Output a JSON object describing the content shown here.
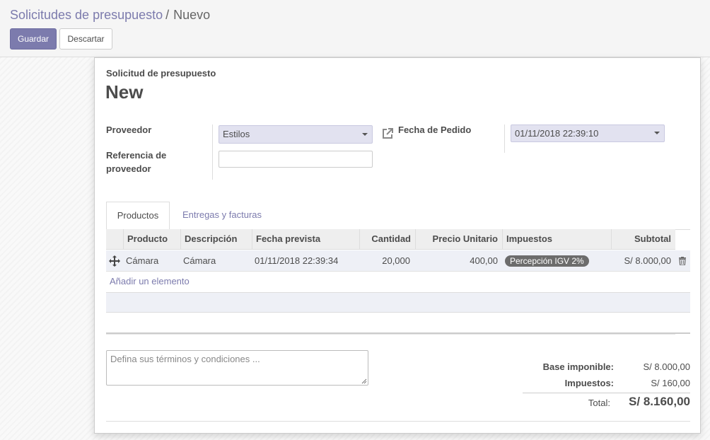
{
  "breadcrumb": {
    "parent": "Solicitudes de presupuesto",
    "separator": "/",
    "current": "Nuevo"
  },
  "toolbar": {
    "save_label": "Guardar",
    "discard_label": "Descartar"
  },
  "form": {
    "doc_type": "Solicitud de presupuesto",
    "name": "New",
    "vendor_label": "Proveedor",
    "vendor_value": "Estilos",
    "vendor_ref_label": "Referencia de proveedor",
    "vendor_ref_value": "",
    "order_date_label": "Fecha de Pedido",
    "order_date_value": "01/11/2018 22:39:10"
  },
  "tabs": [
    {
      "label": "Productos",
      "active": true
    },
    {
      "label": "Entregas y facturas",
      "active": false
    }
  ],
  "table": {
    "headers": [
      "Producto",
      "Descripción",
      "Fecha prevista",
      "Cantidad",
      "Precio Unitario",
      "Impuestos",
      "Subtotal"
    ],
    "rows": [
      {
        "product": "Cámara",
        "description": "Cámara",
        "date": "01/11/2018 22:39:34",
        "qty": "20,000",
        "price": "400,00",
        "tax": "Percepción IGV 2%",
        "subtotal": "S/ 8.000,00"
      }
    ],
    "add_line": "Añadir un elemento"
  },
  "notes": {
    "placeholder": "Defina sus términos y condiciones ..."
  },
  "totals": {
    "untaxed_label": "Base imponible:",
    "untaxed_value": "S/ 8.000,00",
    "tax_label": "Impuestos:",
    "tax_value": "S/ 160,00",
    "total_label": "Total:",
    "total_value": "S/ 8.160,00"
  },
  "colors": {
    "accent": "#7c7bad",
    "select_bg": "#e2e2f0",
    "row_bg": "#eef0f6"
  },
  "icons": [
    "external-link-icon",
    "dropdown-caret-icon",
    "drag-handle-icon",
    "trash-icon"
  ]
}
